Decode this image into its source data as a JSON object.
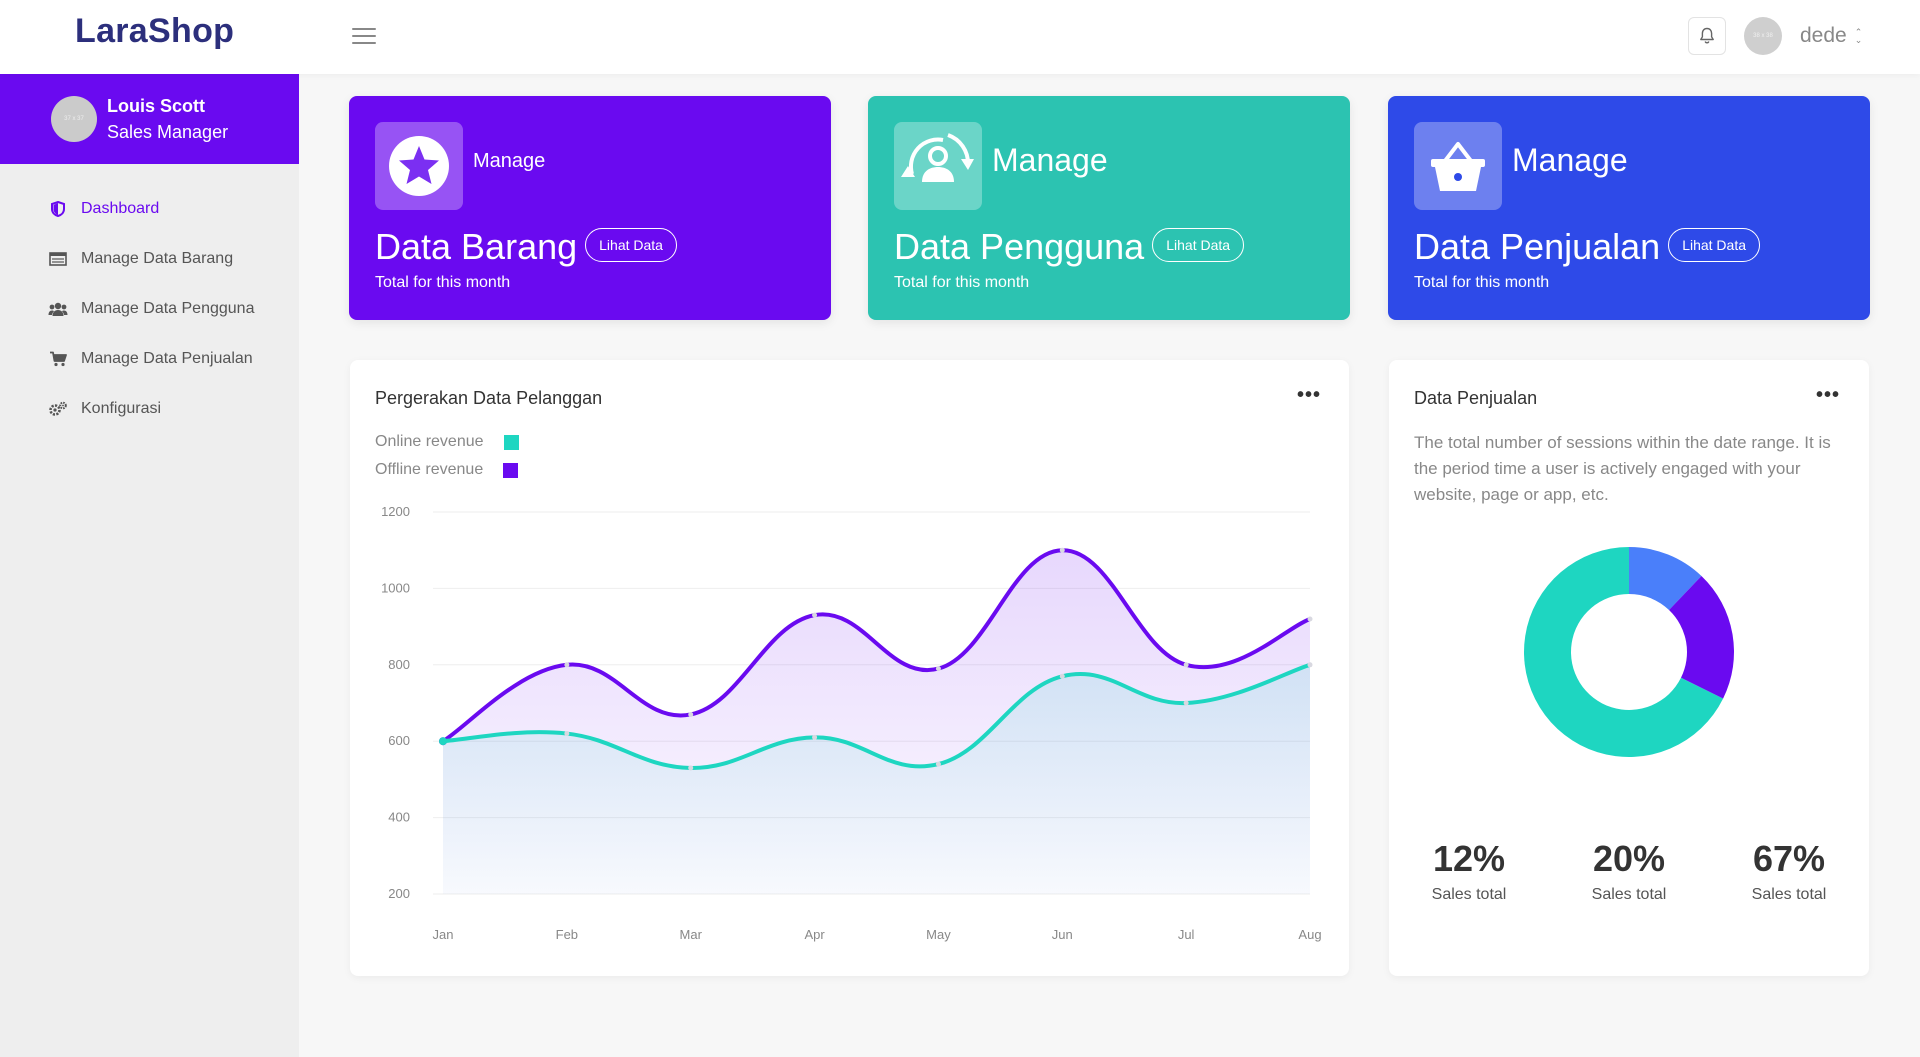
{
  "header": {
    "brand": "LaraShop",
    "avatar_placeholder": "38 x 38",
    "username": "dede"
  },
  "sidebar": {
    "profile": {
      "name": "Louis Scott",
      "role": "Sales Manager",
      "avatar_placeholder": "37 x 37"
    },
    "items": [
      {
        "label": "Dashboard",
        "icon": "shield-icon",
        "active": true
      },
      {
        "label": "Manage Data Barang",
        "icon": "table-icon",
        "active": false
      },
      {
        "label": "Manage Data Pengguna",
        "icon": "users-icon",
        "active": false
      },
      {
        "label": "Manage Data Penjualan",
        "icon": "cart-icon",
        "active": false
      },
      {
        "label": "Konfigurasi",
        "icon": "cogs-icon",
        "active": false
      }
    ]
  },
  "cards": [
    {
      "manage": "Manage",
      "title": "Data Barang",
      "button": "Lihat Data",
      "subtitle": "Total for this month",
      "icon": "star-icon",
      "color": "#6a0af0"
    },
    {
      "manage": "Manage",
      "title": "Data Pengguna",
      "button": "Lihat Data",
      "subtitle": "Total for this month",
      "icon": "user-sync-icon",
      "color": "#2cc3b1"
    },
    {
      "manage": "Manage",
      "title": "Data Penjualan",
      "button": "Lihat Data",
      "subtitle": "Total for this month",
      "icon": "basket-icon",
      "color": "#2e4ae8"
    }
  ],
  "line_panel": {
    "title": "Pergerakan Data Pelanggan",
    "more": "•••"
  },
  "donut_panel": {
    "title": "Data Penjualan",
    "more": "•••",
    "description": "The total number of sessions within the date range. It is the period time a user is actively engaged with your website, page or app, etc.",
    "stats": [
      {
        "value": "12%",
        "label": "Sales total"
      },
      {
        "value": "20%",
        "label": "Sales total"
      },
      {
        "value": "67%",
        "label": "Sales total"
      }
    ]
  },
  "chart_data": [
    {
      "type": "area",
      "title": "Pergerakan Data Pelanggan",
      "categories": [
        "Jan",
        "Feb",
        "Mar",
        "Apr",
        "May",
        "Jun",
        "Jul",
        "Aug"
      ],
      "yticks": [
        200,
        400,
        600,
        800,
        1000,
        1200
      ],
      "ylim": [
        200,
        1200
      ],
      "grid": true,
      "legend_position": "top-left",
      "series": [
        {
          "name": "Online revenue",
          "color": "#1ed6c1",
          "values": [
            600,
            620,
            530,
            610,
            540,
            770,
            700,
            800
          ]
        },
        {
          "name": "Offline revenue",
          "color": "#6a0af0",
          "values": [
            600,
            800,
            670,
            930,
            790,
            1100,
            800,
            920
          ]
        }
      ]
    },
    {
      "type": "pie",
      "title": "Data Penjualan",
      "values": [
        12,
        20,
        67
      ],
      "colors": [
        "#4a7ffa",
        "#6a0af0",
        "#1ed6c1"
      ],
      "donut": true
    }
  ]
}
